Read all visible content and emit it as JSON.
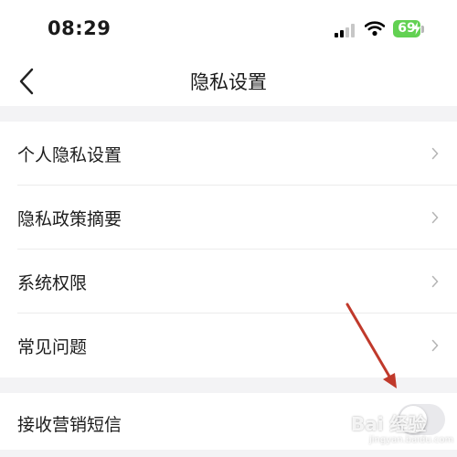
{
  "status_bar": {
    "time": "08:29",
    "battery_level": "69",
    "battery_color": "#62d152",
    "icons": [
      "signal-icon",
      "wifi-icon",
      "battery-icon",
      "charging-bolt-icon"
    ]
  },
  "nav": {
    "title": "隐私设置",
    "back_icon": "chevron-left-icon"
  },
  "menu": {
    "items": [
      {
        "label": "个人隐私设置",
        "icon": "chevron-right-icon"
      },
      {
        "label": "隐私政策摘要",
        "icon": "chevron-right-icon"
      },
      {
        "label": "系统权限",
        "icon": "chevron-right-icon"
      },
      {
        "label": "常见问题",
        "icon": "chevron-right-icon"
      }
    ]
  },
  "toggle_row": {
    "label": "接收营销短信",
    "enabled": false
  },
  "annotation": {
    "arrow_color": "#c0392b"
  },
  "watermark": {
    "text": "Bai 经验",
    "sub": "jingyan.baidu.com"
  }
}
